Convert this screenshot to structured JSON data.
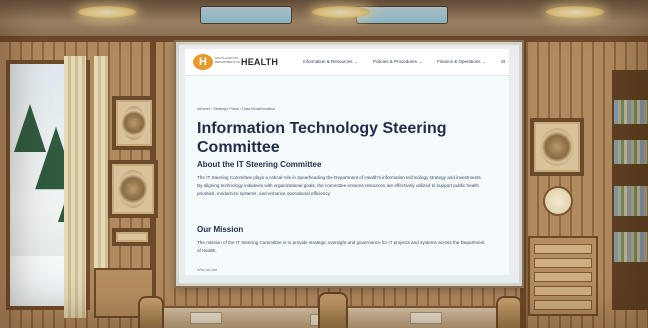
{
  "site": {
    "logo_mark": "H",
    "logo_small_text": "SOUTH DAKOTA DEPARTMENT OF",
    "logo_health": "HEALTH"
  },
  "nav": {
    "items": [
      {
        "label": "Information & Resources",
        "icon": "chevron-down-icon"
      },
      {
        "label": "Policies & Procedures",
        "icon": "chevron-down-icon"
      },
      {
        "label": "Finance & Operations",
        "icon": "chevron-down-icon"
      },
      {
        "label": "St"
      }
    ]
  },
  "breadcrumb": {
    "items": [
      "Intranet",
      "Strategic Plans",
      "Data Modernization"
    ],
    "separator": "›"
  },
  "page": {
    "title": "Information Technology Steering Committee",
    "about_heading": "About the IT Steering Committee",
    "about_text": "The IT Steering Committee plays a critical role in spearheading the Department of Health's information technology strategy and investments. By aligning technology initiatives with organizational goals, the committee ensures resources are effectively utilized to support public health priorities, modernize systems, and enhance operational efficiency.",
    "mission_heading": "Our Mission",
    "mission_text": "The mission of the IT Steering Committee is to provide strategic oversight and governance for IT projects and systems across the Department of Health.",
    "cutoff_text": "Who we are"
  },
  "colors": {
    "accent_orange": "#e79a2b",
    "heading_navy": "#1f2d4a",
    "nav_text": "#2d3a55",
    "screen_bg": "#f5fbfd"
  }
}
